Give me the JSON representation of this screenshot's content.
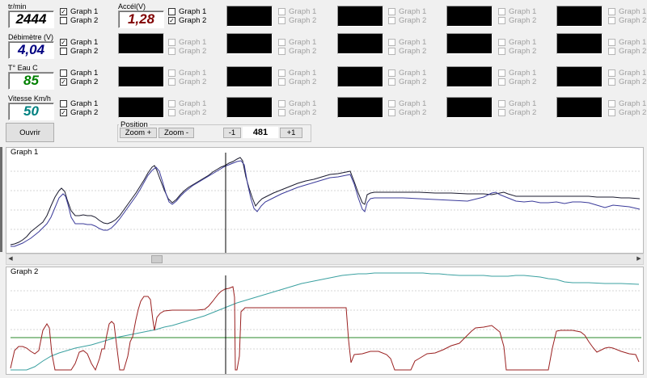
{
  "gauges": [
    {
      "label": "tr/min",
      "value": "2444",
      "color": "#000000"
    },
    {
      "label": "Accél(V)",
      "value": "1,28",
      "color": "#800000"
    },
    {
      "label": "Débimètre (V)",
      "value": "4,04",
      "color": "#000080"
    },
    {
      "label": "T° Eau  C",
      "value": "85",
      "color": "#008000"
    },
    {
      "label": "Vitesse Km/h",
      "value": "50",
      "color": "#008080"
    }
  ],
  "checkbox_labels": {
    "graph1": "Graph 1",
    "graph2": "Graph 2"
  },
  "checks": {
    "rpm": {
      "g1": "✓",
      "g2": ""
    },
    "accel": {
      "g1": "",
      "g2": "✓"
    },
    "debit": {
      "g1": "✓",
      "g2": ""
    },
    "eau": {
      "g1": "",
      "g2": "✓"
    },
    "vitesse": {
      "g1": "",
      "g2": "✓"
    }
  },
  "buttons": {
    "open": "Ouvrir",
    "zoom_in": "Zoom +",
    "zoom_out": "Zoom -",
    "minus": "-1",
    "plus": "+1"
  },
  "position": {
    "title": "Position",
    "value": "481"
  },
  "graph1": {
    "title": "Graph 1"
  },
  "graph2": {
    "title": "Graph 2"
  },
  "colors": {
    "graph1_line_a": "#1a1a2e",
    "graph1_line_b": "#3a3a9a",
    "graph2_cyan": "#3aa0a0",
    "graph2_red": "#9a2020",
    "graph2_green": "#2a8a2a",
    "cursor": "#000000"
  }
}
